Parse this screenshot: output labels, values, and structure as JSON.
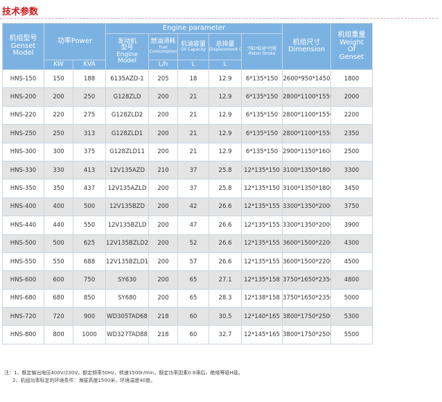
{
  "title": "技术参数",
  "headers": {
    "genset_model": {
      "cn": "机组型号",
      "en1": "Genset",
      "en2": "Model"
    },
    "power": {
      "cn": "功率Power",
      "kw": "KW",
      "kva": "KVA"
    },
    "engine_parameter": "Engine parameter",
    "engine_model": {
      "cn1": "发动机",
      "cn2": "型号",
      "en1": "Engine",
      "en2": "Model"
    },
    "fuel": {
      "cn": "燃油消耗",
      "en1": "Fuel",
      "en2": "Consumption",
      "unit": "L/h"
    },
    "oil": {
      "cn": "机油容量",
      "en": "Oil Capacity",
      "unit": "L"
    },
    "displacement": {
      "cn": "总排量",
      "en": "Displacement Of Piston",
      "unit": "L"
    },
    "stroke": {
      "cn": "汽缸*缸径*行程",
      "en": "Piston Stroke"
    },
    "dimension": {
      "cn": "机组尺寸",
      "en": "Dimension"
    },
    "weight": {
      "cn": "机组重量",
      "en1": "Weight",
      "en2": "Of",
      "en3": "Genset"
    }
  },
  "rows": [
    [
      "HNS-150",
      "150",
      "188",
      "6135AZD-1",
      "205",
      "18",
      "12.9",
      "6*135*150",
      "2600*950*1450",
      "1800"
    ],
    [
      "HNS-200",
      "200",
      "250",
      "G128ZLD",
      "200",
      "21",
      "12.9",
      "6*135*150",
      "2800*1100*1550",
      "2000"
    ],
    [
      "HNS-220",
      "220",
      "275",
      "G128ZLD2",
      "200",
      "21",
      "12.9",
      "6*135*150",
      "2800*1100*1550",
      "2200"
    ],
    [
      "HNS-250",
      "250",
      "313",
      "G128ZLD1",
      "200",
      "21",
      "12.9",
      "6*135*150",
      "2800*1100*1550",
      "2350"
    ],
    [
      "HNS-300",
      "300",
      "375",
      "G128ZLD11",
      "200",
      "21",
      "12.9",
      "6*135*150",
      "2900*1150*1600",
      "2500"
    ],
    [
      "HNS-330",
      "330",
      "413",
      "12V135AZD",
      "210",
      "37",
      "25.8",
      "12*135*150",
      "3100*1350*1800",
      "3300"
    ],
    [
      "HNS-350",
      "350",
      "437",
      "12V135AZLD",
      "200",
      "37",
      "25.8",
      "12*135*150",
      "3100*1350*1800",
      "3450"
    ],
    [
      "HNS-400",
      "400",
      "500",
      "12V135BZD",
      "200",
      "42",
      "26.6",
      "12*135*155",
      "3300*1350*2000",
      "3750"
    ],
    [
      "HNS-440",
      "440",
      "550",
      "12V135BZLD",
      "200",
      "47",
      "26.6",
      "12*135*155",
      "3300*1350*2000",
      "3900"
    ],
    [
      "HNS-500",
      "500",
      "625",
      "12V135BZLD2",
      "200",
      "52",
      "26.6",
      "12*135*155",
      "3600*1500*2200",
      "4300"
    ],
    [
      "HNS-550",
      "550",
      "688",
      "12V135BZLD1",
      "200",
      "57",
      "26.6",
      "12*135*155",
      "3600*1500*2200",
      "4500"
    ],
    [
      "HNS-600",
      "600",
      "750",
      "SY630",
      "200",
      "65",
      "27.1",
      "12*135*158",
      "3750*1650*2350",
      "4800"
    ],
    [
      "HNS-680",
      "680",
      "850",
      "SY680",
      "200",
      "65",
      "28.3",
      "12*138*158",
      "3750*1650*2350",
      "5000"
    ],
    [
      "HNS-720",
      "720",
      "900",
      "WD305TAD68",
      "218",
      "60",
      "30.5",
      "12*140*165",
      "3800*1750*2500",
      "5300"
    ],
    [
      "HNS-800",
      "800",
      "1000",
      "WD327TAD88",
      "218",
      "60",
      "32.7",
      "12*145*165",
      "3800*1750*2500",
      "5500"
    ]
  ],
  "notes": [
    "注：1、额定输出电压400V/230V，额定频率50Hz，转速1500r/min，额定功率因素0.8滞后，绝缘等级H级。",
    "2、机组功率标定的环境条件：海拔高度1500米，环境温度40度。"
  ]
}
